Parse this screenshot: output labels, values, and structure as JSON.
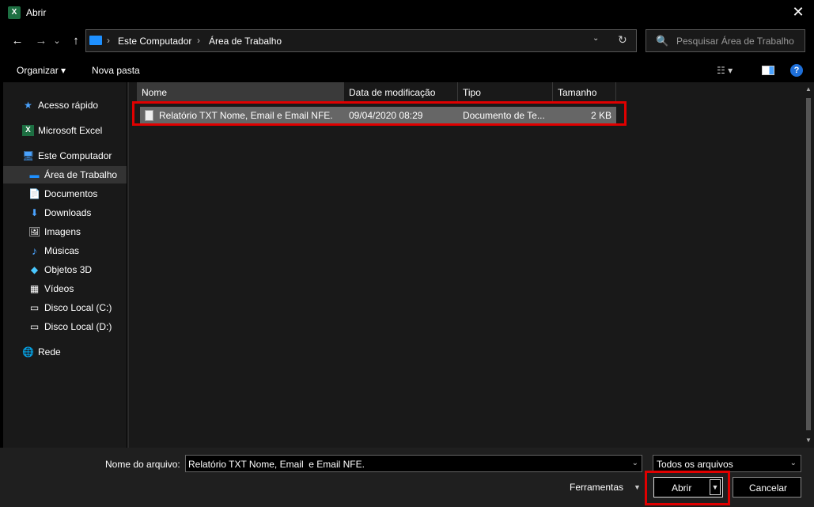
{
  "window": {
    "title": "Abrir",
    "app_icon_letter": "X",
    "close_glyph": "✕"
  },
  "nav": {
    "back_glyph": "←",
    "forward_glyph": "→",
    "recent_glyph": "⌄",
    "up_glyph": "↑"
  },
  "address": {
    "crumbs": [
      "Este Computador",
      "Área de Trabalho"
    ],
    "separator": "›",
    "dropdown_glyph": "⌄",
    "refresh_glyph": "↻"
  },
  "search": {
    "placeholder": "Pesquisar Área de Trabalho",
    "icon": "🔍"
  },
  "toolbar": {
    "organize_label": "Organizar ▾",
    "new_folder_label": "Nova pasta",
    "view_glyph": "☷ ▾",
    "help_glyph": "?"
  },
  "sidebar": {
    "items": [
      {
        "label": "Acesso rápido",
        "icon": "★"
      },
      {
        "label": "Microsoft Excel",
        "icon": "X"
      },
      {
        "label": "Este Computador",
        "icon": "🖥"
      },
      {
        "label": "Área de Trabalho",
        "icon": "▬"
      },
      {
        "label": "Documentos",
        "icon": "📄"
      },
      {
        "label": "Downloads",
        "icon": "⬇"
      },
      {
        "label": "Imagens",
        "icon": "🖼"
      },
      {
        "label": "Músicas",
        "icon": "♪"
      },
      {
        "label": "Objetos 3D",
        "icon": "◆"
      },
      {
        "label": "Vídeos",
        "icon": "▦"
      },
      {
        "label": "Disco Local (C:)",
        "icon": "▭"
      },
      {
        "label": "Disco Local (D:)",
        "icon": "▭"
      },
      {
        "label": "Rede",
        "icon": "🌐"
      }
    ]
  },
  "columns": [
    "Nome",
    "Data de modificação",
    "Tipo",
    "Tamanho"
  ],
  "files": [
    {
      "name": "Relatório TXT Nome, Email  e Email NFE.",
      "modified": "09/04/2020 08:29",
      "type": "Documento de Te...",
      "size": "2 KB"
    }
  ],
  "bottom": {
    "filename_label": "Nome do arquivo:",
    "filename_value": "Relatório TXT Nome, Email  e Email NFE.",
    "filter_value": "Todos os arquivos",
    "tools_label": "Ferramentas",
    "open_label": "Abrir",
    "cancel_label": "Cancelar",
    "dropdown_glyph": "⌄",
    "tools_dropdown_glyph": "▼",
    "split_glyph": "▼"
  },
  "highlight_color": "#e00000"
}
